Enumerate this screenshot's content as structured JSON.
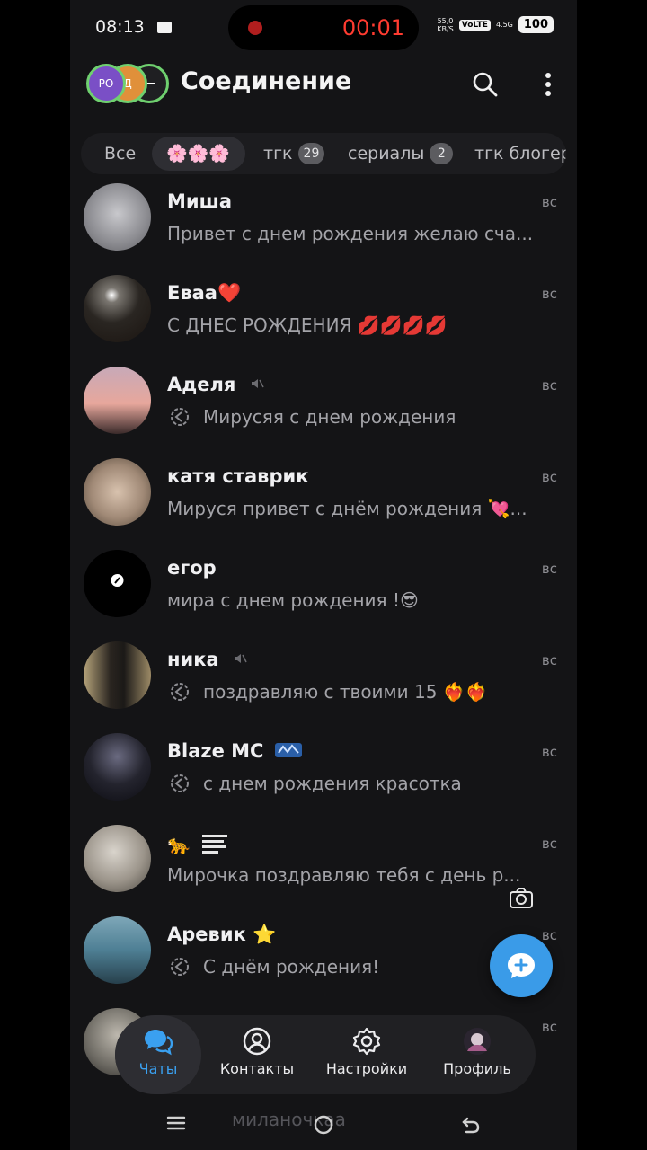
{
  "status_bar": {
    "time": "08:13",
    "recording_timer": "00:01",
    "net_speed": "55,0\nKB/S",
    "volte": "VoLTE",
    "signal": "4.5G",
    "battery": "100"
  },
  "header": {
    "stack_avatars": [
      "РО",
      "Д",
      ""
    ],
    "title": "Соединение",
    "search_icon": "search-icon",
    "menu_icon": "more-vertical-icon"
  },
  "filters": [
    {
      "label": "Все",
      "badge": ""
    },
    {
      "label": "🌸🌸🌸",
      "badge": ""
    },
    {
      "label": "тгк",
      "badge": "29"
    },
    {
      "label": "сериалы",
      "badge": "2"
    },
    {
      "label": "тгк блогер",
      "badge": ""
    }
  ],
  "chats": [
    {
      "name": "Миша",
      "message": "Привет с днем рождения желаю сча...",
      "date": "вс",
      "muted": false,
      "forwarded": false
    },
    {
      "name": "Еваа❤️",
      "message": "С ДНЕС РОЖДЕНИЯ 💋💋💋💋",
      "date": "вс",
      "muted": false,
      "forwarded": false
    },
    {
      "name": "Аделя",
      "message": "Мирусяя с днем рождения",
      "date": "вс",
      "muted": true,
      "forwarded": true
    },
    {
      "name": "катя ставрик",
      "message": "Мируся привет с днём рождения 💘...",
      "date": "вс",
      "muted": false,
      "forwarded": false
    },
    {
      "name": "егор",
      "message": "мира с днем рождения !😎",
      "date": "вс",
      "muted": false,
      "forwarded": false
    },
    {
      "name": "ника",
      "message": "поздравляю с твоими 15 ❤️‍🔥❤️‍🔥",
      "date": "вс",
      "muted": true,
      "forwarded": true
    },
    {
      "name": "Blaze MC",
      "message": "с днем рождения красотка",
      "date": "вс",
      "muted": false,
      "forwarded": true
    },
    {
      "name": "🐆",
      "message": "Мирочка поздравляю тебя с день р...",
      "date": "вс",
      "muted": false,
      "forwarded": false
    },
    {
      "name": "Аревик ⭐",
      "message": "С днём рождения!",
      "date": "вс",
      "muted": false,
      "forwarded": true
    },
    {
      "name": "",
      "message": "",
      "date": "вс",
      "muted": false,
      "forwarded": false
    }
  ],
  "bottom_nav": [
    {
      "label": "Чаты",
      "icon": "chats-icon",
      "active": true
    },
    {
      "label": "Контакты",
      "icon": "contacts-icon",
      "active": false
    },
    {
      "label": "Настройки",
      "icon": "settings-icon",
      "active": false
    },
    {
      "label": "Профиль",
      "icon": "profile-avatar",
      "active": false
    }
  ],
  "ghost_text": "миланочкаа",
  "colors": {
    "background": "#141416",
    "accent": "#3a9be8",
    "recording": "#ff3b30"
  }
}
